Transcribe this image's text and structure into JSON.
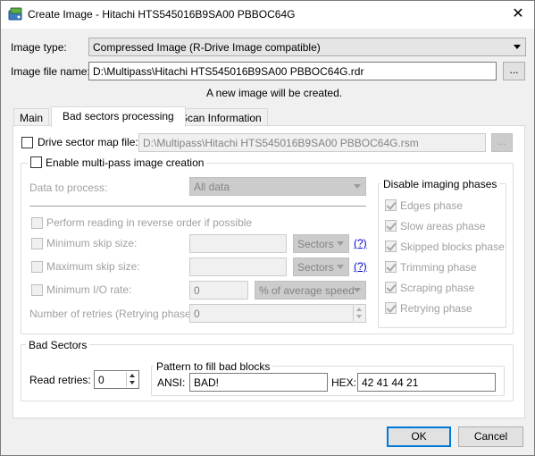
{
  "window": {
    "title": "Create Image - Hitachi HTS545016B9SA00 PBBOC64G",
    "close_glyph": "✕"
  },
  "top": {
    "image_type_label": "Image type:",
    "image_type_value": "Compressed Image (R-Drive Image compatible)",
    "image_file_label": "Image file name:",
    "image_file_value": "D:\\Multipass\\Hitachi HTS545016B9SA00 PBBOC64G.rdr",
    "browse_label": "...",
    "status_text": "A new image will be created."
  },
  "tabs": [
    {
      "label": "Main"
    },
    {
      "label": "Bad sectors processing"
    },
    {
      "label": "Scan Information"
    }
  ],
  "bad_sectors_tab": {
    "drive_map_label": "Drive sector map file:",
    "drive_map_value": "D:\\Multipass\\Hitachi HTS545016B9SA00 PBBOC64G.rsm",
    "drive_map_browse": "...",
    "multipass_label": "Enable multi-pass image creation",
    "data_to_process_label": "Data to process:",
    "data_to_process_value": "All data",
    "reverse_label": "Perform reading in reverse order if possible",
    "min_skip_label": "Minimum skip size:",
    "min_skip_unit": "Sectors",
    "max_skip_label": "Maximum skip size:",
    "max_skip_unit": "Sectors",
    "help_label": "(?)",
    "min_io_label": "Minimum I/O rate:",
    "min_io_value": "0",
    "min_io_unit": "% of average speed",
    "retries_phase_label": "Number of retries (Retrying phase):",
    "retries_phase_value": "0",
    "disable_phases_title": "Disable imaging phases",
    "phases": [
      {
        "label": "Edges phase"
      },
      {
        "label": "Slow areas phase"
      },
      {
        "label": "Skipped blocks phase"
      },
      {
        "label": "Trimming phase"
      },
      {
        "label": "Scraping phase"
      },
      {
        "label": "Retrying phase"
      }
    ],
    "bad_sectors_title": "Bad Sectors",
    "read_retries_label": "Read retries:",
    "read_retries_value": "0",
    "pattern_title": "Pattern to fill bad blocks",
    "ansi_label": "ANSI:",
    "ansi_value": "BAD!",
    "hex_label": "HEX:",
    "hex_value": "42 41 44 21"
  },
  "footer": {
    "ok_label": "OK",
    "cancel_label": "Cancel"
  }
}
